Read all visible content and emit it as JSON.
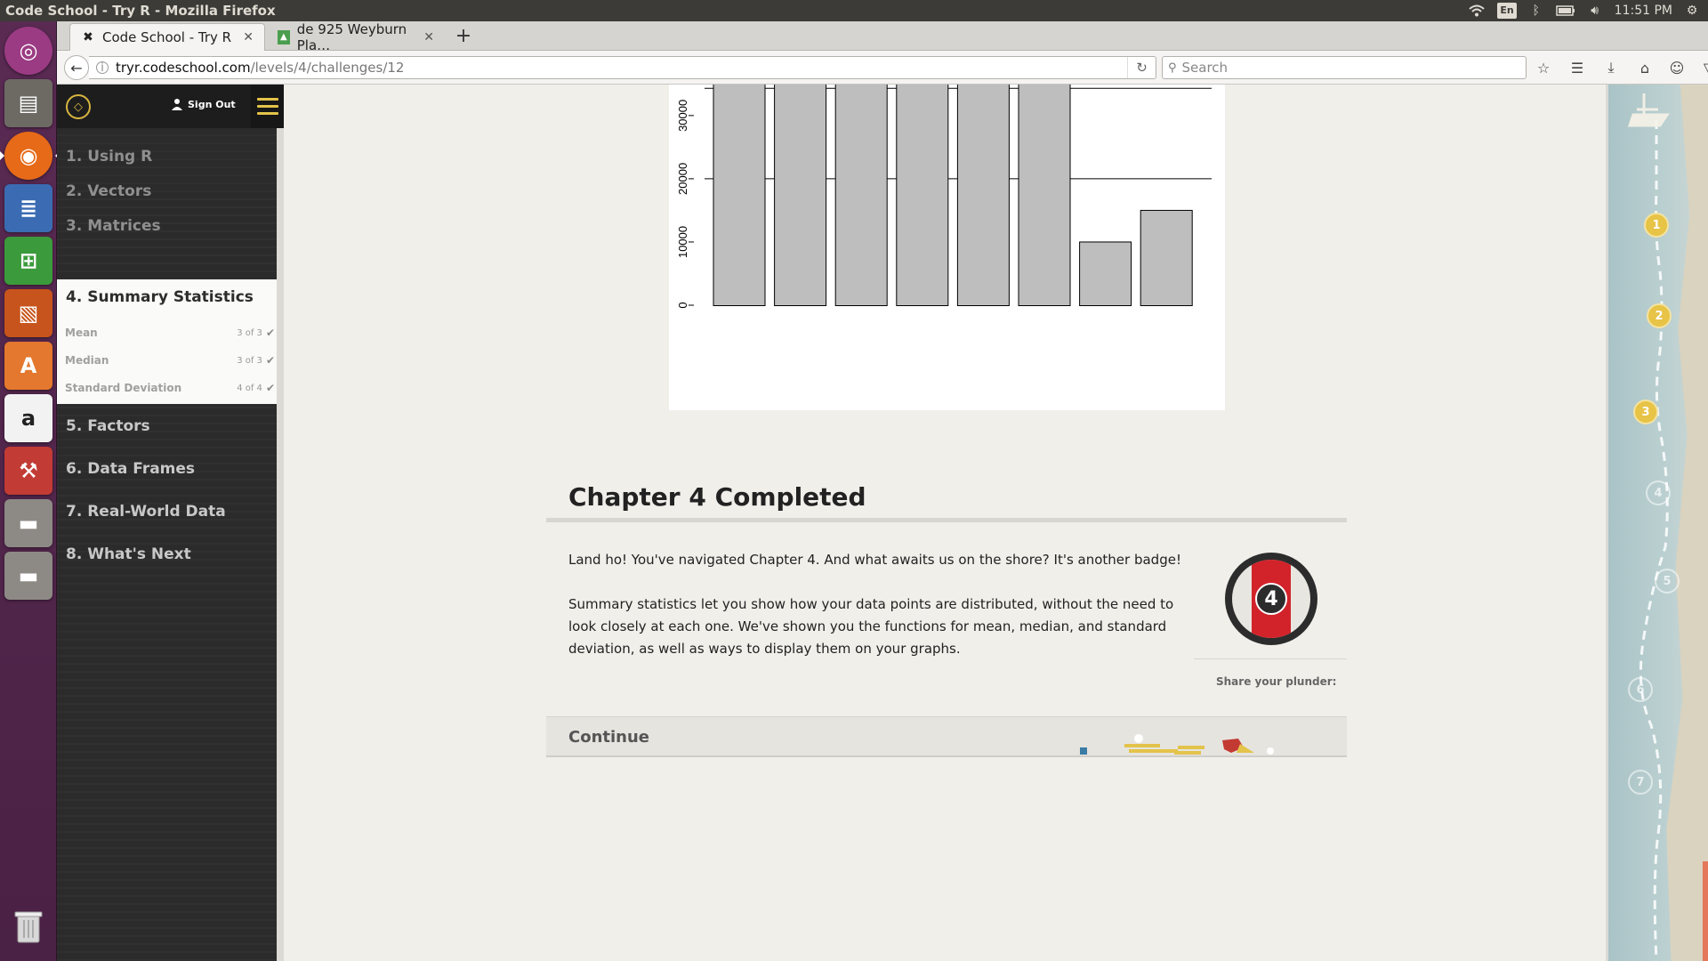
{
  "os": {
    "window_title": "Code School - Try R - Mozilla Firefox",
    "keyboard_layout": "En",
    "clock": "11:51 PM"
  },
  "browser": {
    "tabs": [
      {
        "label": "Code School - Try R",
        "active": true
      },
      {
        "label": "de 925 Weyburn Pla…",
        "active": false
      }
    ],
    "url_host": "tryr.codeschool.com",
    "url_path": "/levels/4/challenges/12",
    "search_placeholder": "Search"
  },
  "sidebar": {
    "sign_out": "Sign Out",
    "chapters": [
      {
        "label": "1. Using R"
      },
      {
        "label": "2. Vectors"
      },
      {
        "label": "3. Matrices"
      },
      {
        "label": "4. Summary Statistics"
      },
      {
        "label": "5. Factors"
      },
      {
        "label": "6. Data Frames"
      },
      {
        "label": "7. Real-World Data"
      },
      {
        "label": "8. What's Next"
      }
    ],
    "current_subitems": [
      {
        "label": "Mean",
        "progress": "3 of 3"
      },
      {
        "label": "Median",
        "progress": "3 of 3"
      },
      {
        "label": "Standard Deviation",
        "progress": "4 of 4"
      }
    ]
  },
  "chart_data": {
    "type": "bar",
    "values": [
      40000,
      40000,
      35000,
      40000,
      35000,
      40000,
      10000,
      15000
    ],
    "y_ticks": [
      "0",
      "10000",
      "20000",
      "30000"
    ],
    "hlines": [
      20000,
      34300
    ],
    "ylim": [
      0,
      38000
    ],
    "bar_color": "#bebebe",
    "clipped_at_top": true
  },
  "main": {
    "chapter_title": "Chapter 4 Completed",
    "paragraph_1": "Land ho! You've navigated Chapter 4. And what awaits us on the shore? It's another badge!",
    "paragraph_2": "Summary statistics let you show how your data points are distributed, without the need to look closely at each one. We've shown you the functions for mean, median, and standard deviation, as well as ways to display them on your graphs.",
    "badge_number": "4",
    "share_label": "Share your plunder:",
    "continue_label": "Continue"
  },
  "map": {
    "markers": [
      "1",
      "2",
      "3",
      "4",
      "5",
      "6",
      "7"
    ],
    "completed_count": 3
  },
  "colors": {
    "accent_gold": "#e7c346",
    "badge_red": "#d2232a",
    "launcher_purple": "#5a2a53"
  }
}
